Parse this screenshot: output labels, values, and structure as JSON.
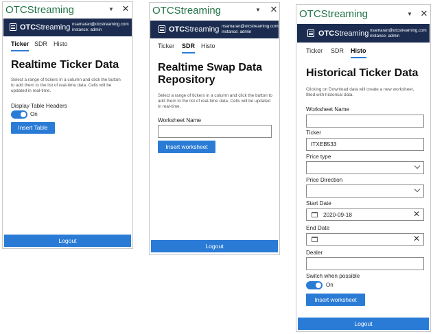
{
  "app_title": "OTCStreaming",
  "brand": {
    "prefix": "OTC",
    "suffix": "Streaming"
  },
  "user": {
    "email": "nsamaran@otcstreaming.com",
    "instance": "instance: admin"
  },
  "tabs": [
    "Ticker",
    "SDR",
    "Histo"
  ],
  "logout_label": "Logout",
  "panel1": {
    "active_tab": "Ticker",
    "heading": "Realtime Ticker Data",
    "description": "Select a range of tickers in a column and click the button to add them to the list of real-time data. Cells will be updated in real-time.",
    "toggle_label": "Display Table Headers",
    "toggle_state": "On",
    "button": "Insert Table"
  },
  "panel2": {
    "active_tab": "SDR",
    "heading": "Realtime Swap Data Repository",
    "description": "Select a range of tickers in a column and click the button to add them to the list of real-time data. Cells will be updated in real-time.",
    "field_label": "Worksheet Name",
    "field_value": "",
    "button": "Insert worksheet"
  },
  "panel3": {
    "active_tab": "Histo",
    "heading": "Historical Ticker Data",
    "description": "Clicking on Download data will create a new worksheet, filled with historical data.",
    "worksheet_label": "Worksheet Name",
    "worksheet_value": "",
    "ticker_label": "Ticker",
    "ticker_value": "ITXEB533",
    "price_type_label": "Price type",
    "price_type_value": "",
    "price_direction_label": "Price Direction",
    "price_direction_value": "",
    "start_date_label": "Start Date",
    "start_date_value": "2020-09-18",
    "end_date_label": "End Date",
    "end_date_value": "",
    "dealer_label": "Dealer",
    "dealer_value": "",
    "switch_label": "Switch when possible",
    "switch_state": "On",
    "button": "Insert worksheet"
  }
}
